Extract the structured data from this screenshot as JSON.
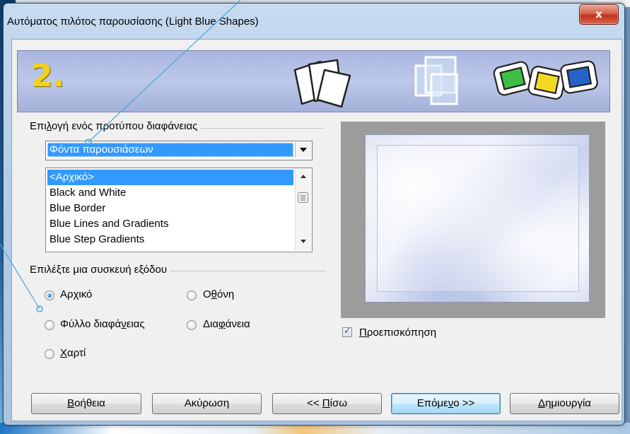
{
  "window": {
    "title": "Αυτόματος πιλότος παρουσίασης (Light Blue Shapes)",
    "close_symbol": "x"
  },
  "banner": {
    "step": "2.",
    "icons": [
      "sheets-icon",
      "overlapping-slides-icon",
      "colored-slides-icon"
    ]
  },
  "template_group": {
    "label_pre": "Επι",
    "label_access": "λ",
    "label_post": "ογή ενός προτύπου διαφάνειας",
    "category_selected": "Φόντα παρουσιάσεων",
    "items": [
      "<Αρχικό>",
      "Black and White",
      "Blue Border",
      "Blue Lines and Gradients",
      "Blue Step Gradients"
    ],
    "selected_index": 0
  },
  "output_group": {
    "label": "Επιλέξτε μια συσκευή εξόδου",
    "options": [
      {
        "pre": "Αρχικό",
        "access": "",
        "post": "",
        "checked": true
      },
      {
        "pre": "Ο",
        "access": "θ",
        "post": "όνη",
        "checked": false
      },
      {
        "pre": "Φύλλο διαφά",
        "access": "ν",
        "post": "ειας",
        "checked": false
      },
      {
        "pre": "Δια",
        "access": "φ",
        "post": "άνεια",
        "checked": false
      },
      {
        "pre": "",
        "access": "Χ",
        "post": "αρτί",
        "checked": false
      }
    ]
  },
  "preview": {
    "checkbox_label_access": "Π",
    "checkbox_label_post": "ροεπισκόπηση",
    "checked": true
  },
  "buttons": {
    "help": {
      "access": "Β",
      "post": "οήθεια"
    },
    "cancel": {
      "label": "Ακύρωση"
    },
    "back": {
      "pre": "<< ",
      "access": "Π",
      "post": "ίσω"
    },
    "next": {
      "pre": "Επόμε",
      "access": "ν",
      "post": "ο >>"
    },
    "create": {
      "access": "Δ",
      "post": "ημιουργία"
    }
  },
  "colors": {
    "selection": "#3399ff",
    "step_number": "#f2d31a",
    "callout": "#4aa7d6"
  }
}
